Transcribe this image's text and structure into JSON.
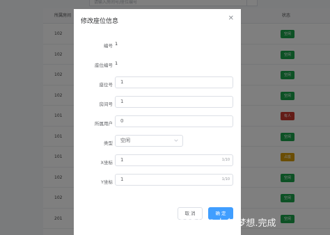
{
  "background": {
    "search_placeholder": "请输入房间号/座位编号",
    "table": {
      "header_room": "所属房间",
      "header_status": "状态",
      "rows": [
        {
          "room": "102",
          "status": "空闲",
          "status_color": "#1aa34a"
        },
        {
          "room": "102",
          "status": "空闲",
          "status_color": "#1aa34a"
        },
        {
          "room": "102",
          "status": "空闲",
          "status_color": "#1aa34a"
        },
        {
          "room": "102",
          "status": "空闲",
          "status_color": "#1aa34a"
        },
        {
          "room": "101",
          "status": "有人",
          "status_color": "#c7392e"
        },
        {
          "room": "101",
          "status": "空闲",
          "status_color": "#1aa34a"
        },
        {
          "room": "101",
          "status": "占座",
          "status_color": "#d49a08"
        },
        {
          "room": "102",
          "status": "空闲",
          "status_color": "#1aa34a"
        },
        {
          "room": "102",
          "status": "空闲",
          "status_color": "#1aa34a"
        },
        {
          "room": "201",
          "status": "空闲",
          "status_color": "#1aa34a"
        }
      ]
    }
  },
  "dialog": {
    "title": "修改座位信息",
    "close_icon": "close-icon",
    "fields": {
      "id_label": "编号",
      "id_value": "1",
      "seat_code_label": "座位编号",
      "seat_code_value": "1",
      "seat_no_label": "座位号",
      "seat_no_value": "1",
      "room_no_label": "房间号",
      "room_no_value": "1",
      "owner_label": "所属用户",
      "owner_value": "0",
      "type_label": "类型",
      "type_value": "空闲",
      "x_label": "X坐标",
      "x_value": "1",
      "x_count": "1/10",
      "y_label": "Y坐标",
      "y_value": "1",
      "y_count": "1/10"
    },
    "cancel_label": "取 消",
    "ok_label": "确 定"
  },
  "watermark": "CSDN @大多.梦想.完成"
}
